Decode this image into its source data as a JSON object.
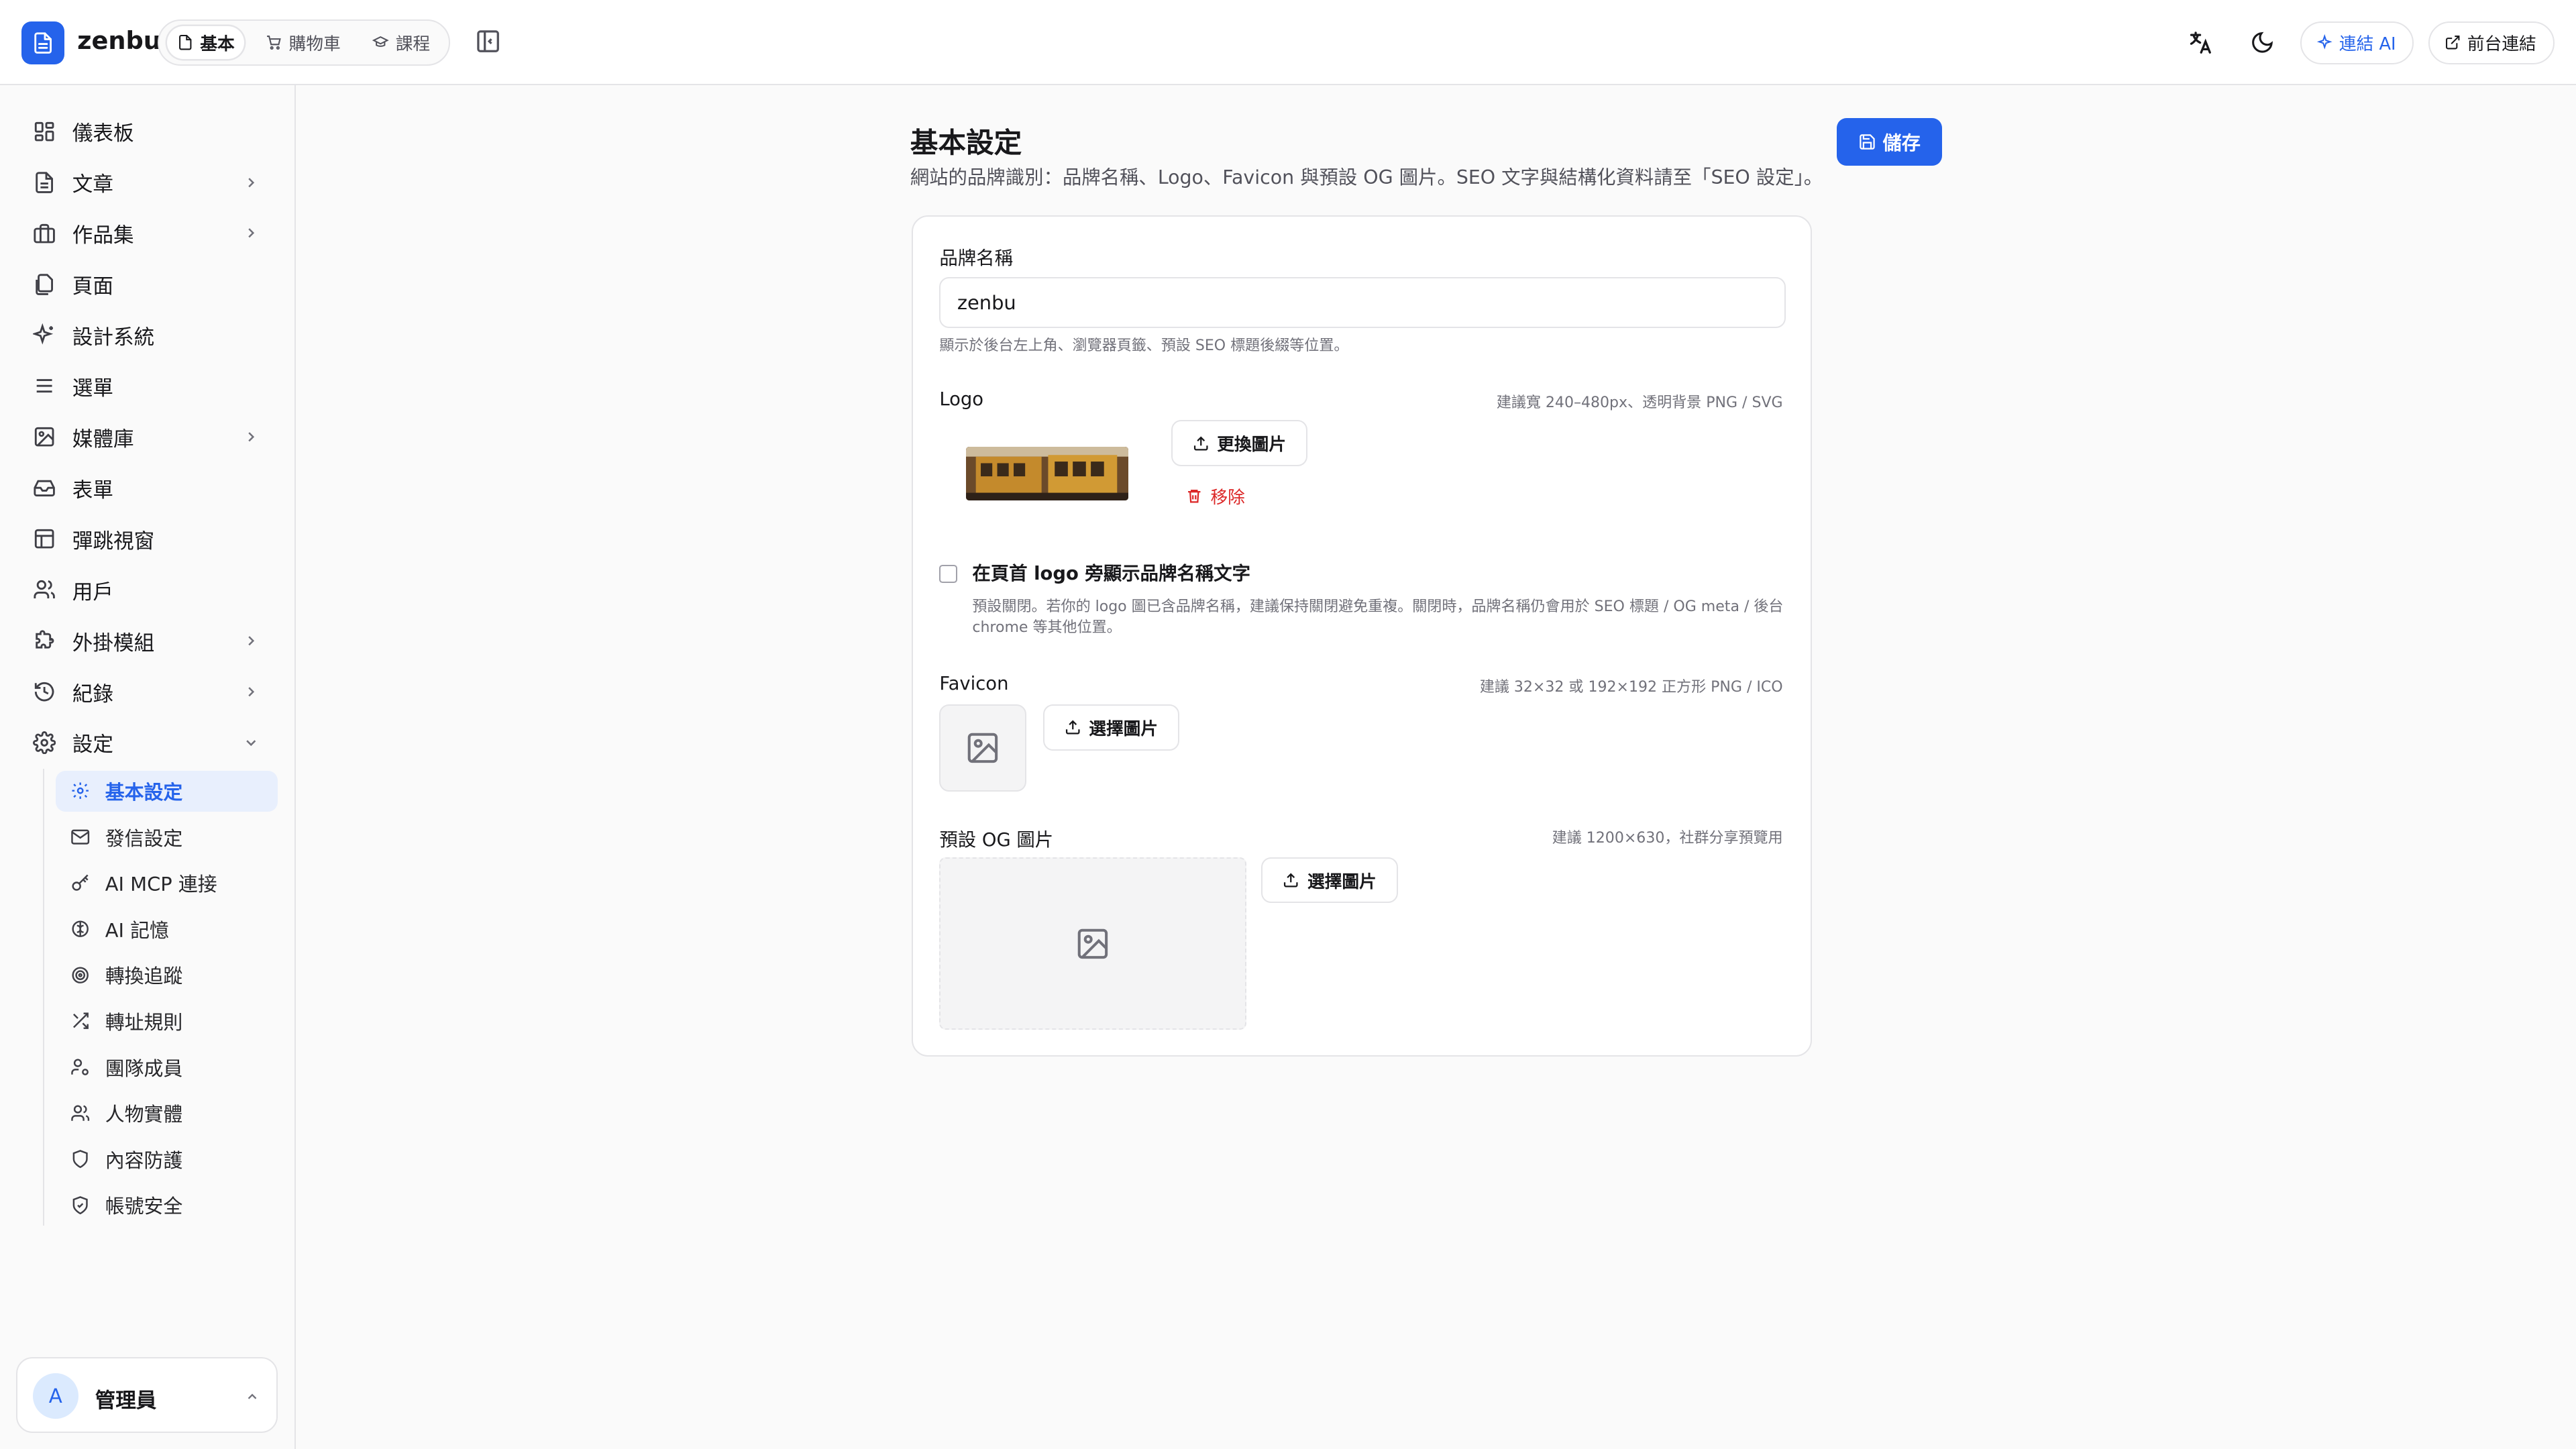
{
  "app": {
    "name": "zenbu"
  },
  "topbar": {
    "modes": [
      {
        "label": "基本",
        "icon": "file-icon",
        "active": true
      },
      {
        "label": "購物車",
        "icon": "cart-icon",
        "active": false
      },
      {
        "label": "課程",
        "icon": "graduation-cap-icon",
        "active": false
      }
    ],
    "connect_ai_label": "連結 AI",
    "frontend_link_label": "前台連結"
  },
  "sidebar": {
    "items": [
      {
        "label": "儀表板",
        "icon": "dashboard-icon",
        "has_children": false
      },
      {
        "label": "文章",
        "icon": "file-text-icon",
        "has_children": true
      },
      {
        "label": "作品集",
        "icon": "briefcase-icon",
        "has_children": true
      },
      {
        "label": "頁面",
        "icon": "files-icon",
        "has_children": false
      },
      {
        "label": "設計系統",
        "icon": "sparkles-icon",
        "has_children": false
      },
      {
        "label": "選單",
        "icon": "menu-icon",
        "has_children": false
      },
      {
        "label": "媒體庫",
        "icon": "image-icon",
        "has_children": true
      },
      {
        "label": "表單",
        "icon": "inbox-icon",
        "has_children": false
      },
      {
        "label": "彈跳視窗",
        "icon": "layout-icon",
        "has_children": false
      },
      {
        "label": "用戶",
        "icon": "users-icon",
        "has_children": false
      },
      {
        "label": "外掛模組",
        "icon": "puzzle-icon",
        "has_children": true
      },
      {
        "label": "紀錄",
        "icon": "history-icon",
        "has_children": true
      },
      {
        "label": "設定",
        "icon": "settings-icon",
        "has_children": true,
        "expanded": true
      }
    ],
    "settings_children": [
      {
        "label": "基本設定",
        "icon": "gear-icon",
        "active": true
      },
      {
        "label": "發信設定",
        "icon": "mail-icon"
      },
      {
        "label": "AI MCP 連接",
        "icon": "key-icon"
      },
      {
        "label": "AI 記憶",
        "icon": "brain-icon"
      },
      {
        "label": "轉換追蹤",
        "icon": "target-icon"
      },
      {
        "label": "轉址規則",
        "icon": "shuffle-icon"
      },
      {
        "label": "團隊成員",
        "icon": "user-cog-icon"
      },
      {
        "label": "人物實體",
        "icon": "users-icon"
      },
      {
        "label": "內容防護",
        "icon": "shield-icon"
      },
      {
        "label": "帳號安全",
        "icon": "shield-check-icon"
      }
    ],
    "user": {
      "initial": "A",
      "name": "管理員"
    }
  },
  "main": {
    "title": "基本設定",
    "description": "網站的品牌識別：品牌名稱、Logo、Favicon 與預設 OG 圖片。SEO 文字與結構化資料請至「SEO 設定」。",
    "save_label": "儲存",
    "brand_name": {
      "label": "品牌名稱",
      "value": "zenbu",
      "hint": "顯示於後台左上角、瀏覽器頁籤、預設 SEO 標題後綴等位置。"
    },
    "logo": {
      "label": "Logo",
      "hint": "建議寬 240–480px、透明背景 PNG / SVG",
      "replace_label": "更換圖片",
      "remove_label": "移除"
    },
    "show_brand_text": {
      "label": "在頁首 logo 旁顯示品牌名稱文字",
      "checked": false,
      "hint": "預設關閉。若你的 logo 圖已含品牌名稱，建議保持關閉避免重複。關閉時，品牌名稱仍會用於 SEO 標題 / OG meta / 後台 chrome 等其他位置。"
    },
    "favicon": {
      "label": "Favicon",
      "hint": "建議 32×32 或 192×192 正方形 PNG / ICO",
      "choose_label": "選擇圖片"
    },
    "og_image": {
      "label": "預設 OG 圖片",
      "hint": "建議 1200×630，社群分享預覽用",
      "choose_label": "選擇圖片"
    }
  },
  "colors": {
    "accent": "#2563eb",
    "danger": "#dc2626",
    "border": "#e4e4e7"
  }
}
